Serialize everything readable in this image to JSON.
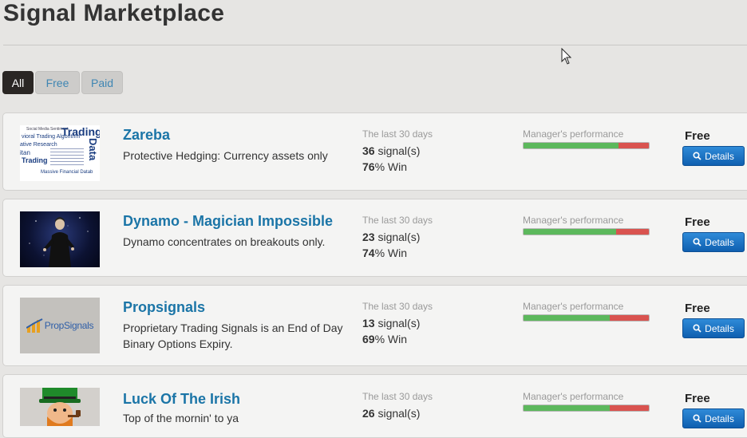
{
  "page": {
    "title": "Signal Marketplace"
  },
  "filters": [
    {
      "label": "All",
      "active": true
    },
    {
      "label": "Free",
      "active": false
    },
    {
      "label": "Paid",
      "active": false
    }
  ],
  "labels": {
    "period": "The last 30 days",
    "signals_suffix": " signal(s)",
    "win_suffix": "% Win",
    "performance": "Manager's performance",
    "details": "Details"
  },
  "listings": [
    {
      "name": "Zareba",
      "description": "Protective Hedging: Currency assets only",
      "signals": "36",
      "win": "76",
      "performance_pct": 76,
      "price": "Free",
      "thumb": "wordcloud",
      "thumb_words": [
        "Social Media Sentiment",
        "Trading",
        "vioral Trading Algorithm",
        "Data",
        "ative Research",
        "itan",
        "Trading",
        "Massive Financial Datab"
      ]
    },
    {
      "name": "Dynamo - Magician Impossible",
      "description": "Dynamo concentrates on breakouts only.",
      "signals": "23",
      "win": "74",
      "performance_pct": 74,
      "price": "Free",
      "thumb": "magician"
    },
    {
      "name": "Propsignals",
      "description": "Proprietary Trading Signals is an End of Day Binary Options Expiry.",
      "signals": "13",
      "win": "69",
      "performance_pct": 69,
      "price": "Free",
      "thumb": "logo",
      "thumb_logo_text": "PropSignals"
    },
    {
      "name": "Luck Of The Irish",
      "description": "Top of the mornin' to ya",
      "signals": "26",
      "win": "",
      "performance_pct": 69,
      "price": "Free",
      "thumb": "leprechaun"
    }
  ],
  "colors": {
    "accent": "#1b75a7",
    "bar_good": "#5cb85c",
    "bar_bad": "#d9534f",
    "button": "#0f5fb0",
    "active_filter": "#2a2624"
  }
}
